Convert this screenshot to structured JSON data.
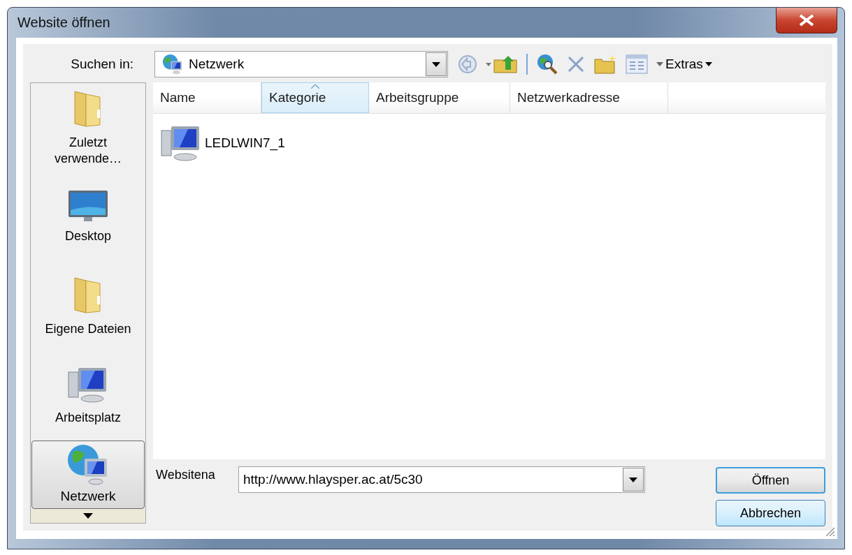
{
  "window": {
    "title": "Website öffnen"
  },
  "look_in": {
    "label": "Suchen in:",
    "value": "Netzwerk"
  },
  "toolbar": {
    "extras": "Extras"
  },
  "sidebar": {
    "items": [
      {
        "label": "Zuletzt verwende…",
        "kind": "recent",
        "selected": false
      },
      {
        "label": "Desktop",
        "kind": "desktop",
        "selected": false
      },
      {
        "label": "Eigene Dateien",
        "kind": "documents",
        "selected": false
      },
      {
        "label": "Arbeitsplatz",
        "kind": "computer",
        "selected": false
      },
      {
        "label": "Netzwerk",
        "kind": "network",
        "selected": true
      }
    ]
  },
  "table": {
    "columns": [
      {
        "label": "Name",
        "sorted": false
      },
      {
        "label": "Kategorie",
        "sorted": true
      },
      {
        "label": "Arbeitsgruppe",
        "sorted": false
      },
      {
        "label": "Netzwerkadresse",
        "sorted": false
      }
    ],
    "rows": [
      {
        "name": "LEDLWIN7_1"
      }
    ]
  },
  "filename": {
    "label": "Websitena",
    "value": "http://www.hlaysper.ac.at/5c30"
  },
  "buttons": [
    {
      "label": "Öffnen",
      "default": true
    },
    {
      "label": "Abbrechen",
      "default": false
    }
  ]
}
